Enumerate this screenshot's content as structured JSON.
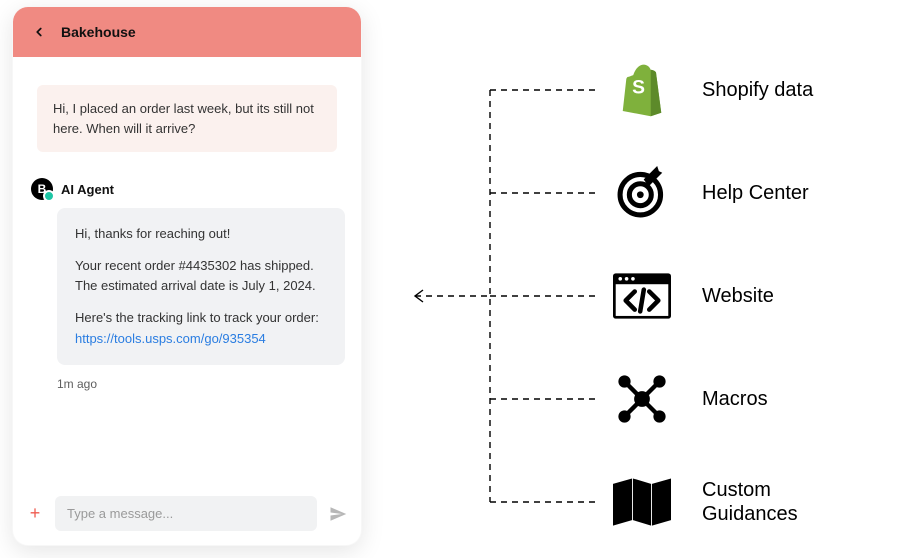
{
  "chat": {
    "brand": "Bakehouse",
    "user_message": "Hi, I placed an order last week, but its still not here. When will it arrive?",
    "agent_name": "AI Agent",
    "agent_avatar_letter": "B",
    "agent_p1": "Hi, thanks for reaching out!",
    "agent_p2": "Your recent order #4435302 has shipped. The estimated arrival date is July 1, 2024.",
    "agent_p3_prefix": "Here's the tracking link to track your order:",
    "agent_link": "https://tools.usps.com/go/935354",
    "timestamp": "1m ago",
    "input_placeholder": "Type a message..."
  },
  "sources": {
    "shopify": "Shopify data",
    "help_center": "Help Center",
    "website": "Website",
    "macros": "Macros",
    "guidances": "Custom Guidances"
  }
}
